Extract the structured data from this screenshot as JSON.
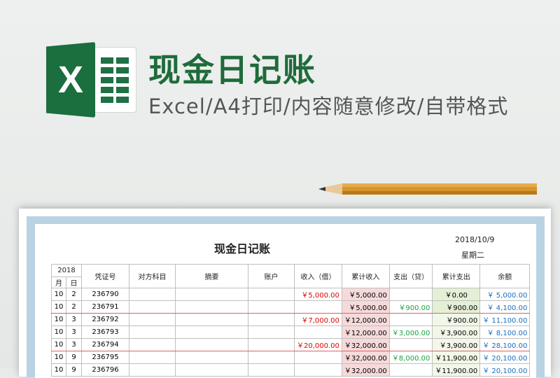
{
  "banner": {
    "title": "现金日记账",
    "subtitle": "Excel/A4打印/内容随意修改/自带格式",
    "logo_letter": "X",
    "brand_color": "#1b6e3e"
  },
  "sheet": {
    "title": "现金日记账",
    "date": "2018/10/9",
    "weekday": "星期二",
    "year": "2018",
    "columns": {
      "month": "月",
      "day": "日",
      "voucher": "凭证号",
      "account": "对方科目",
      "summary": "摘要",
      "ledger": "账户",
      "income": "收入（借）",
      "cum_income": "累计收入",
      "expense": "支出（贷）",
      "cum_expense": "累计支出",
      "balance": "余额"
    },
    "rows": [
      {
        "m": "10",
        "d": "2",
        "v": "236790",
        "inc": "￥5,000.00",
        "cinc": "￥5,000.00",
        "exp": "",
        "cexp": "￥0.00",
        "bal": "￥   5,000.00"
      },
      {
        "m": "10",
        "d": "2",
        "v": "236791",
        "inc": "",
        "cinc": "￥5,000.00",
        "exp": "￥900.00",
        "cexp": "￥900.00",
        "bal": "￥   4,100.00"
      },
      {
        "m": "10",
        "d": "3",
        "v": "236792",
        "inc": "￥7,000.00",
        "cinc": "￥12,000.00",
        "exp": "",
        "cexp": "￥900.00",
        "bal": "￥  11,100.00"
      },
      {
        "m": "10",
        "d": "3",
        "v": "236793",
        "inc": "",
        "cinc": "￥12,000.00",
        "exp": "￥3,000.00",
        "cexp": "￥3,900.00",
        "bal": "￥   8,100.00"
      },
      {
        "m": "10",
        "d": "3",
        "v": "236794",
        "inc": "￥20,000.00",
        "cinc": "￥32,000.00",
        "exp": "",
        "cexp": "￥3,900.00",
        "bal": "￥  28,100.00"
      },
      {
        "m": "10",
        "d": "9",
        "v": "236795",
        "inc": "",
        "cinc": "￥32,000.00",
        "exp": "￥8,000.00",
        "cexp": "￥11,900.00",
        "bal": "￥  20,100.00"
      },
      {
        "m": "10",
        "d": "9",
        "v": "236796",
        "inc": "",
        "cinc": "￥32,000.00",
        "exp": "",
        "cexp": "￥11,900.00",
        "bal": "￥  20,100.00"
      }
    ]
  }
}
